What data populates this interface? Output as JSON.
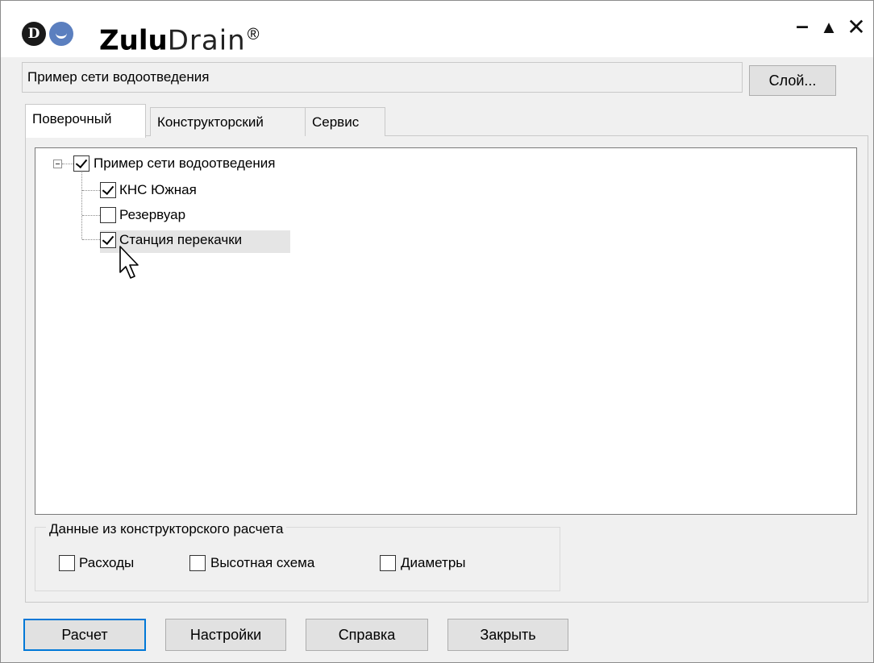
{
  "window": {
    "app_name_bold": "Zulu",
    "app_name_light": "Drain",
    "registered_mark": "®",
    "logo_letter": "D",
    "controls": {
      "minimize": "–",
      "maximize": "▲",
      "close": "✕"
    }
  },
  "layer": {
    "name": "Пример сети водоотведения",
    "button_label": "Слой..."
  },
  "tabs": [
    {
      "label": "Поверочный",
      "active": true
    },
    {
      "label": "Конструкторский",
      "active": false
    },
    {
      "label": "Сервис",
      "active": false
    }
  ],
  "tree": {
    "root": {
      "label": "Пример сети водоотведения",
      "checked": true,
      "expanded": true
    },
    "children": [
      {
        "label": "КНС Южная",
        "checked": true
      },
      {
        "label": "Резервуар",
        "checked": false
      },
      {
        "label": "Станция перекачки",
        "checked": true,
        "selected": true
      }
    ]
  },
  "design_data": {
    "title": "Данные из конструкторского расчета",
    "options": [
      {
        "label": "Расходы",
        "checked": false
      },
      {
        "label": "Высотная схема",
        "checked": false
      },
      {
        "label": "Диаметры",
        "checked": false
      }
    ]
  },
  "buttons": {
    "calculate": "Расчет",
    "settings": "Настройки",
    "help": "Справка",
    "close": "Закрыть"
  },
  "colors": {
    "accent": "#0078d7",
    "dialog_bg": "#f0f0f0",
    "logo_face": "#5b7fbf"
  }
}
